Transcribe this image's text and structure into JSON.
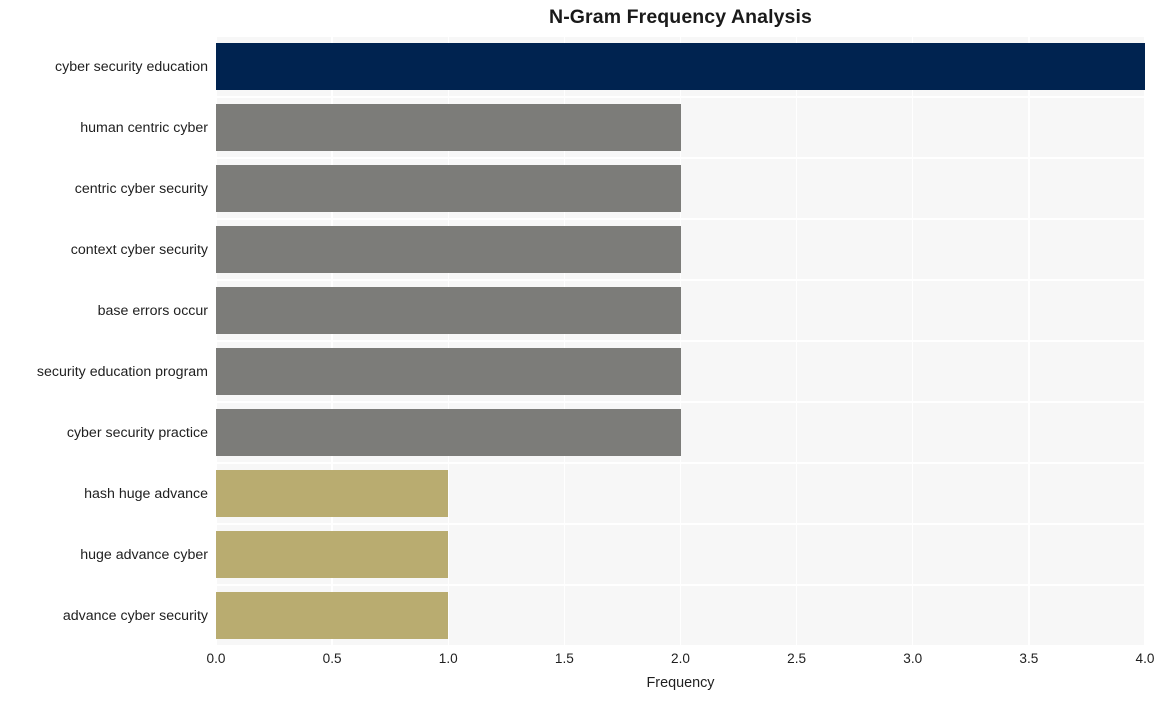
{
  "chart_data": {
    "type": "bar",
    "orientation": "horizontal",
    "title": "N-Gram Frequency Analysis",
    "xlabel": "Frequency",
    "ylabel": "",
    "categories": [
      "cyber security education",
      "human centric cyber",
      "centric cyber security",
      "context cyber security",
      "base errors occur",
      "security education program",
      "cyber security practice",
      "hash huge advance",
      "huge advance cyber",
      "advance cyber security"
    ],
    "values": [
      4,
      2,
      2,
      2,
      2,
      2,
      2,
      1,
      1,
      1
    ],
    "bar_colors": [
      "#002350",
      "#7c7c79",
      "#7c7c79",
      "#7c7c79",
      "#7c7c79",
      "#7c7c79",
      "#7c7c79",
      "#b9ac70",
      "#b9ac70",
      "#b9ac70"
    ],
    "xlim": [
      0,
      4
    ],
    "xticks": [
      0,
      0.5,
      1,
      1.5,
      2,
      2.5,
      3,
      3.5,
      4
    ],
    "xtick_labels": [
      "0.0",
      "0.5",
      "1.0",
      "1.5",
      "2.0",
      "2.5",
      "3.0",
      "3.5",
      "4.0"
    ],
    "grid": true,
    "grid_color": "#ffffff",
    "plot_background": "#f7f7f7",
    "figure_background": "#ffffff",
    "legend": null
  },
  "colors": {
    "highest": "#002350",
    "middle": "#7c7c79",
    "lowest": "#b9ac70",
    "plot_bg": "#f7f7f7",
    "grid": "#ffffff",
    "text": "#1f1f1f"
  }
}
